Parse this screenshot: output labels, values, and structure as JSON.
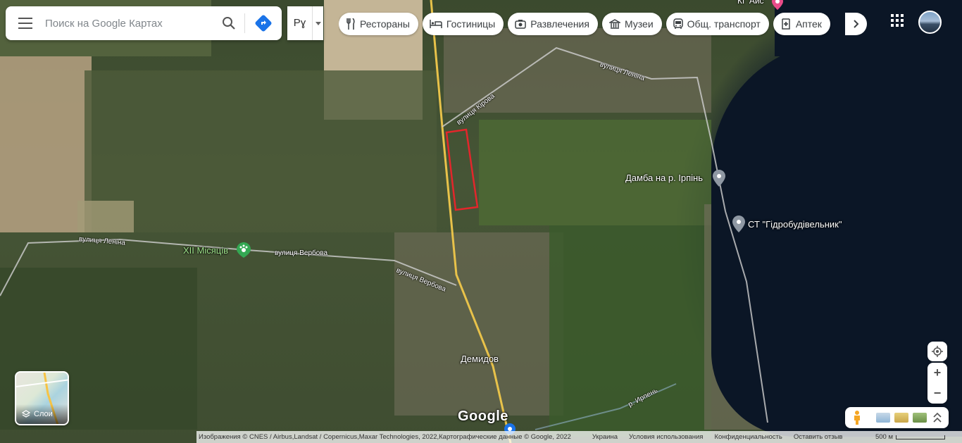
{
  "search": {
    "placeholder": "Поиск на Google Картах"
  },
  "language": {
    "label": "Рɣ"
  },
  "chips": [
    {
      "label": "Рестораны",
      "icon": "fork-knife-icon"
    },
    {
      "label": "Гостиницы",
      "icon": "bed-icon"
    },
    {
      "label": "Развлечения",
      "icon": "camera-icon"
    },
    {
      "label": "Музеи",
      "icon": "museum-icon"
    },
    {
      "label": "Общ. транспорт",
      "icon": "bus-icon"
    },
    {
      "label": "Аптек",
      "icon": "pharmacy-icon"
    }
  ],
  "map_labels": {
    "top_fragment": "КГ Аис",
    "road_kirova": "вулиця Кірова",
    "road_lenina_ne": "вулиця Леніна",
    "road_lenina_w": "вулиця Леніна",
    "road_verbova_1": "вулиця Вербова",
    "road_verbova_2": "вулиця Вербова",
    "place_xii": "XII Місяців",
    "place_damba": "Дамба на р. Ірпінь",
    "place_st": "СТ \"Гідробудівельник\"",
    "place_demidov": "Демидов",
    "river_irpin": "р. Ирпень"
  },
  "layers": {
    "label": "Слои"
  },
  "logo": "Google",
  "footer": {
    "attribution": "Изображения © CNES / Airbus,Landsat / Copernicus,Maxar Technologies, 2022,Картографические данные © Google, 2022",
    "country": "Украина",
    "terms": "Условия использования",
    "privacy": "Конфиденциальность",
    "feedback": "Оставить отзыв",
    "scale": "500 м"
  },
  "colors": {
    "highlight_rect": "#e3262b",
    "water": "#0b1626",
    "accent_blue": "#1a73e8"
  }
}
